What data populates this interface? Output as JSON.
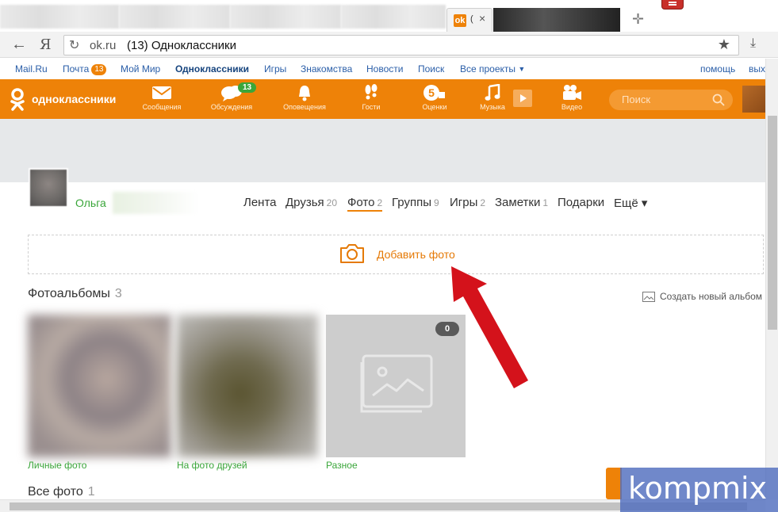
{
  "browser": {
    "active_tab": {
      "title_fragment": "(",
      "favicon": "ok-favicon-icon"
    },
    "address": {
      "host": "ok.ru",
      "title": "(13) Одноклассники"
    }
  },
  "portal": {
    "items": [
      {
        "label": "Mail.Ru"
      },
      {
        "label": "Почта",
        "badge": "13"
      },
      {
        "label": "Мой Мир"
      },
      {
        "label": "Одноклассники"
      },
      {
        "label": "Игры"
      },
      {
        "label": "Знакомства"
      },
      {
        "label": "Новости"
      },
      {
        "label": "Поиск"
      },
      {
        "label": "Все проекты"
      }
    ],
    "help": "помощь",
    "logout": "вых"
  },
  "toolbar": {
    "logo": "одноклассники",
    "items": [
      {
        "label": "Сообщения",
        "icon": "envelope-icon"
      },
      {
        "label": "Обсуждения",
        "icon": "chat-bubbles-icon",
        "badge": "13"
      },
      {
        "label": "Оповещения",
        "icon": "bell-icon"
      },
      {
        "label": "Гости",
        "icon": "footprints-icon"
      },
      {
        "label": "Оценки",
        "icon": "rating-5-icon"
      },
      {
        "label": "Музыка",
        "icon": "music-note-icon"
      },
      {
        "label": "Видео",
        "icon": "video-camera-icon"
      }
    ],
    "search_placeholder": "Поиск",
    "accent": "#ee8208"
  },
  "profile": {
    "name": "Ольга",
    "nav": [
      {
        "label": "Лента",
        "count": ""
      },
      {
        "label": "Друзья",
        "count": "20"
      },
      {
        "label": "Фото",
        "count": "2",
        "active": true
      },
      {
        "label": "Группы",
        "count": "9"
      },
      {
        "label": "Игры",
        "count": "2"
      },
      {
        "label": "Заметки",
        "count": "1"
      },
      {
        "label": "Подарки",
        "count": ""
      },
      {
        "label": "Ещё ▾",
        "count": ""
      }
    ]
  },
  "photos": {
    "add_photo": "Добавить фото",
    "albums_title": "Фотоальбомы",
    "albums_count": "3",
    "create_album": "Создать новый альбом",
    "albums": [
      {
        "caption": "Личные фото"
      },
      {
        "caption": "На фото друзей"
      },
      {
        "caption": "Разное",
        "count": "0"
      }
    ],
    "all_title": "Все фото",
    "all_count": "1"
  },
  "watermark": "kompmix"
}
